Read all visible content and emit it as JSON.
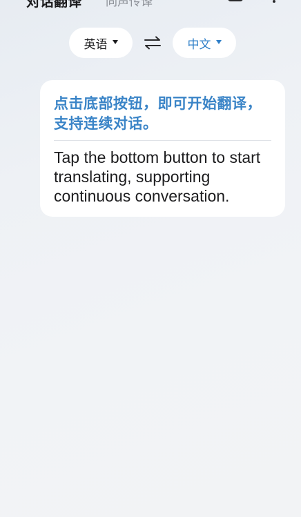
{
  "header": {
    "title": "对话翻译",
    "mode_tab": "同声传译",
    "history_icon": "history-icon",
    "more_icon": "more-vertical-icon"
  },
  "language_bar": {
    "source_language": "英语",
    "target_language": "中文",
    "swap_icon": "swap-arrows-icon",
    "colors": {
      "target_accent": "#2f7fc8"
    }
  },
  "conversation": {
    "messages": [
      {
        "source_text": "点击底部按钮，即可开始翻译，支持连续对话。",
        "translated_text": "Tap the bottom button to start translating, supporting continuous conversation."
      }
    ],
    "colors": {
      "source_text": "#3a84c7",
      "translated_text": "#1c1c1e"
    }
  }
}
